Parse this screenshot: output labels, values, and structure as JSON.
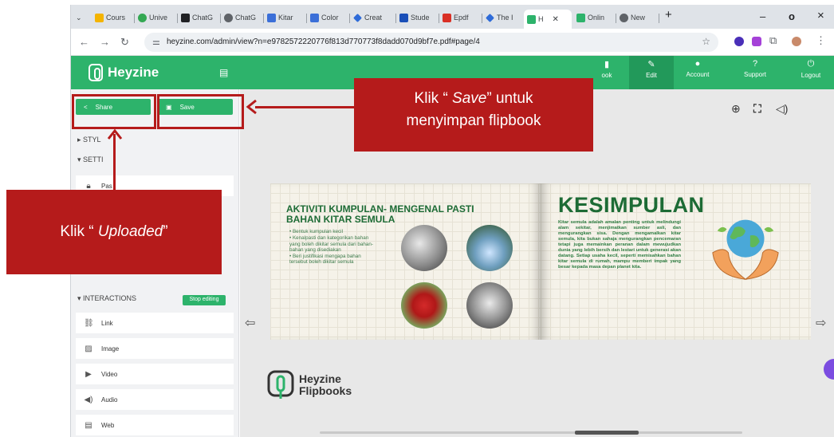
{
  "browser": {
    "tabs": [
      "Cours",
      "Unive",
      "ChatG",
      "ChatG",
      "Kitar",
      "Color",
      "Creat",
      "Stude",
      "Epdf",
      "The I",
      "H",
      "Onlin",
      "New"
    ],
    "tab_active_index": 10,
    "url": "heyzine.com/admin/view?n=e9782572220776f813d770773f8dadd070d9bf7e.pdf#page/4",
    "new_tab": "+",
    "minimize": "–",
    "maximize": "o",
    "close": "×"
  },
  "header": {
    "brand": "Heyzine",
    "nav": [
      {
        "label": "",
        "icon": "circle-icon"
      },
      {
        "label": "",
        "icon": "grid-icon"
      },
      {
        "label": "",
        "icon": "brush-icon"
      },
      {
        "label": "ook",
        "icon": "book-icon"
      },
      {
        "label": "Edit",
        "icon": "pencil-icon"
      },
      {
        "label": "Account",
        "icon": "user-icon"
      },
      {
        "label": "Support",
        "icon": "question-icon"
      },
      {
        "label": "Logout",
        "icon": "power-icon"
      }
    ],
    "active_nav": "Edit",
    "accent_color": "#2db36b"
  },
  "sidebar": {
    "share_label": "Share",
    "save_label": "Save",
    "styles_label": "STYL",
    "settings_label": "SETTI",
    "password_label": "Pas",
    "interactions_label": "INTERACTIONS",
    "stop_editing_label": "Stop editing",
    "interactions": [
      {
        "label": "Link",
        "icon": "link-icon"
      },
      {
        "label": "Image",
        "icon": "image-icon"
      },
      {
        "label": "Video",
        "icon": "play-icon"
      },
      {
        "label": "Audio",
        "icon": "speaker-icon"
      },
      {
        "label": "Web",
        "icon": "web-icon"
      }
    ]
  },
  "book": {
    "left_title": "AKTIVITI KUMPULAN- MENGENAL PASTI BAHAN KITAR SEMULA",
    "left_bullets": [
      "Bentuk kumpulan kecil",
      "Kenalpasti dan kategorikan bahan yang boleh dikitar semula dari bahan-bahan yang disediakan",
      "Beri justifikasi mengapa bahan tersebut boleh dikitar semula"
    ],
    "right_title": "KESIMPULAN",
    "right_text": "Kitar semula adalah amalan penting untuk melindungi alam sekitar, menjimatkan sumber asli, dan mengurangkan sisa. Dengan mengamalkan kitar semula, kita bukan sahaja mengurangkan pencemaran tetapi juga memainkan peranan dalam mewujudkan dunia yang lebih bersih dan lestari untuk generasi akan datang. Setiap usaha kecil, seperti memisahkan bahan kitar semula di rumah, mampu memberi impak yang besar kepada masa depan planet kita."
  },
  "branding": {
    "line1": "Heyzine",
    "line2": "Flipbooks"
  },
  "annotations": {
    "save_callout_prefix": "Klik  “ ",
    "save_callout_italic": "Save",
    "save_callout_suffix": "” untuk",
    "save_callout_line2": "menyimpan flipbook",
    "uploaded_callout_prefix": "Klik  “ ",
    "uploaded_callout_italic": "Uploaded",
    "uploaded_callout_suffix": "”",
    "callout_color": "#b51b1b"
  }
}
